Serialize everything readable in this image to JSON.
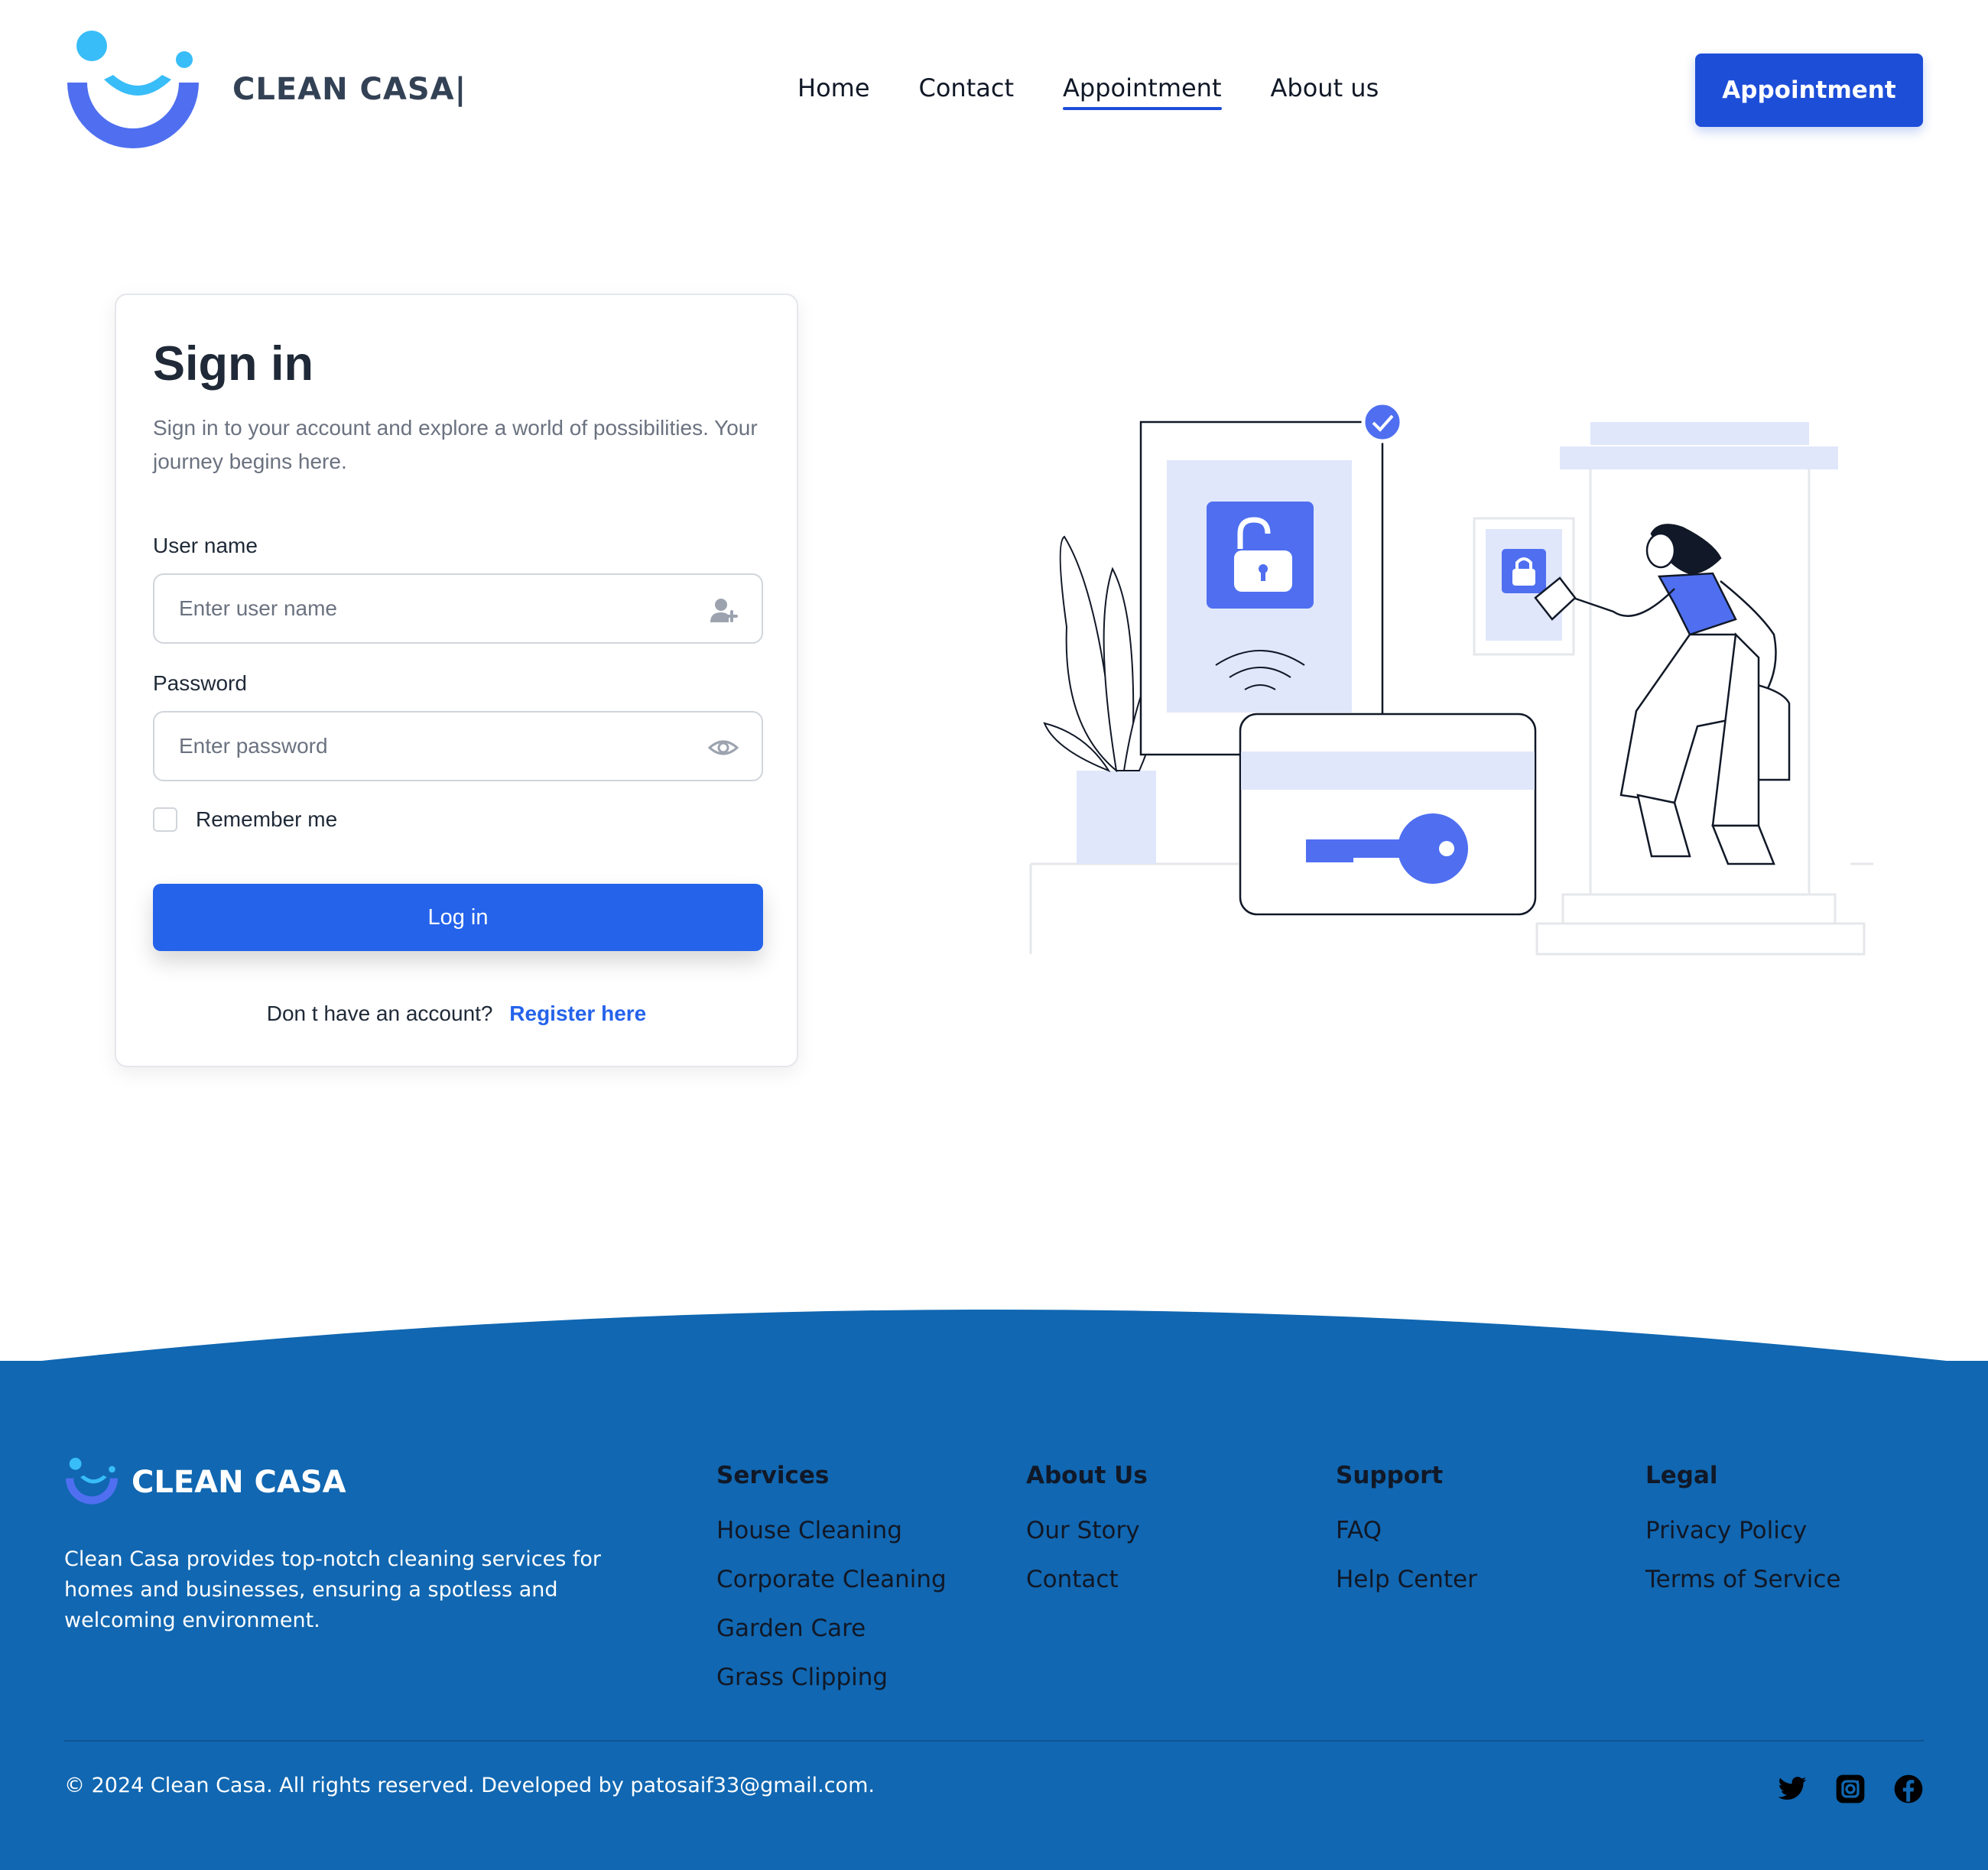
{
  "header": {
    "brand": "CLEAN CASA|",
    "nav": [
      {
        "label": "Home",
        "active": false
      },
      {
        "label": "Contact",
        "active": false
      },
      {
        "label": "Appointment",
        "active": true
      },
      {
        "label": "About us",
        "active": false
      }
    ],
    "cta_label": "Appointment"
  },
  "signin": {
    "title": "Sign in",
    "description": "Sign in to your account and explore a world of possibilities. Your journey begins here.",
    "username_label": "User name",
    "username_placeholder": "Enter user name",
    "password_label": "Password",
    "password_placeholder": "Enter password",
    "remember_label": "Remember me",
    "login_label": "Log in",
    "no_account_text": "Don t have an account?",
    "register_label": "Register here"
  },
  "footer": {
    "brand": "CLEAN CASA",
    "description": "Clean Casa provides top-notch cleaning services for homes and businesses, ensuring a spotless and welcoming environment.",
    "columns": [
      {
        "heading": "Services",
        "links": [
          "House Cleaning",
          "Corporate Cleaning",
          "Garden Care",
          "Grass Clipping"
        ]
      },
      {
        "heading": "About Us",
        "links": [
          "Our Story",
          "Contact"
        ]
      },
      {
        "heading": "Support",
        "links": [
          "FAQ",
          "Help Center"
        ]
      },
      {
        "heading": "Legal",
        "links": [
          "Privacy Policy",
          "Terms of Service"
        ]
      }
    ],
    "copyright": "© 2024 Clean Casa. All rights reserved. Developed by patosaif33@gmail.com.",
    "social_icons": [
      "twitter-icon",
      "instagram-icon",
      "facebook-icon"
    ]
  },
  "colors": {
    "primary": "#1d4ed8",
    "button": "#2563eb",
    "footer_bg": "#1167b1",
    "illustration_accent": "#4f6ff0",
    "illustration_light": "#e0e7fb"
  }
}
